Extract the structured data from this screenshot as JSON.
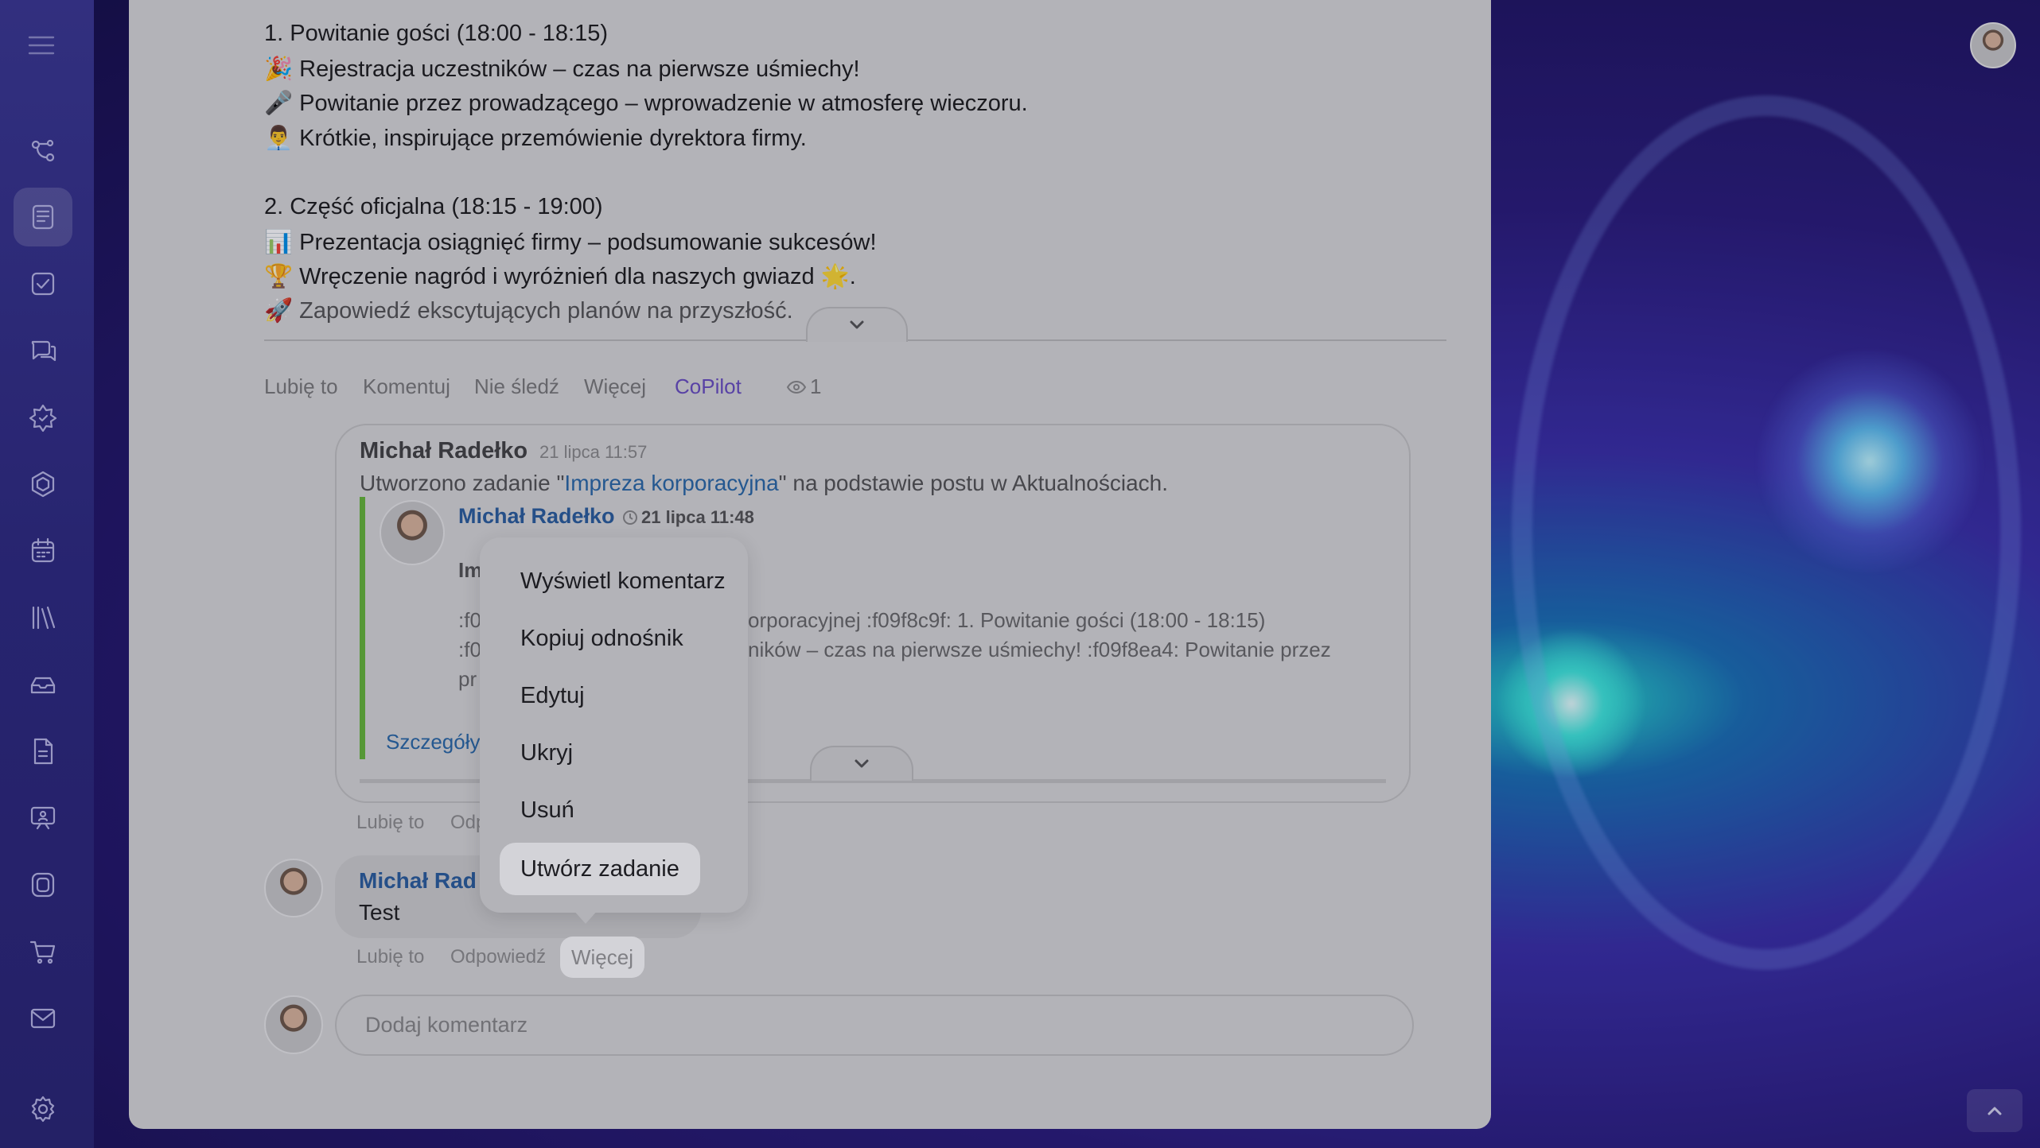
{
  "post": {
    "lines": [
      "1. Powitanie gości (18:00 - 18:15)",
      "🎉 Rejestracja uczestników – czas na pierwsze uśmiechy!",
      "🎤 Powitanie przez prowadzącego – wprowadzenie w atmosferę wieczoru.",
      "👨‍💼 Krótkie, inspirujące przemówienie dyrektora firmy.",
      "2. Część oficjalna (18:15 - 19:00)",
      "📊 Prezentacja osiągnięć firmy – podsumowanie sukcesów!",
      "🏆 Wręczenie nagród i wyróżnień dla naszych gwiazd 🌟.",
      "🚀 Zapowiedź ekscytujących planów na przyszłość."
    ]
  },
  "post_actions": {
    "like": "Lubię to",
    "comment": "Komentuj",
    "unfollow": "Nie śledź",
    "more": "Więcej",
    "copilot": "CoPilot",
    "views": "1"
  },
  "task_card": {
    "author": "Michał Radełko",
    "time": "21 lipca 11:57",
    "text_before": "Utworzono zadanie \"",
    "task_link": "Impreza korporacyjna",
    "text_after": "\" na podstawie postu w Aktualnościach.",
    "quote": {
      "author": "Michał Radełko",
      "time": "21 lipca 11:48",
      "title_partial": "Im",
      "line1_left": ":f0",
      "line1_right": "orporacyjnej :f09f8c9f: 1. Powitanie gości (18:00 - 18:15)",
      "line2_left": ":f0",
      "line2_right": "ników – czas na pierwsze uśmiechy! :f09f8ea4: Powitanie przez",
      "line3_left": "pr",
      "details": "Szczegóły"
    },
    "like": "Lubię to",
    "reply_partial": "Odp"
  },
  "comment": {
    "author_partial": "Michał Rad",
    "text": "Test",
    "like": "Lubię to",
    "reply": "Odpowiedź",
    "more": "Więcej"
  },
  "comment_input": {
    "placeholder": "Dodaj komentarz"
  },
  "context_menu": {
    "items": [
      "Wyświetl komentarz",
      "Kopiuj odnośnik",
      "Edytuj",
      "Ukryj",
      "Usuń",
      "Utwórz zadanie"
    ]
  },
  "sidebar": {
    "icons": [
      "workflow-icon",
      "news-icon",
      "tasks-icon",
      "chat-icon",
      "ai-star-icon",
      "groups-icon",
      "calendar-icon",
      "library-icon",
      "inbox-icon",
      "document-icon",
      "presentation-icon",
      "sites-icon",
      "cart-icon",
      "mail-icon",
      "settings-icon"
    ]
  }
}
